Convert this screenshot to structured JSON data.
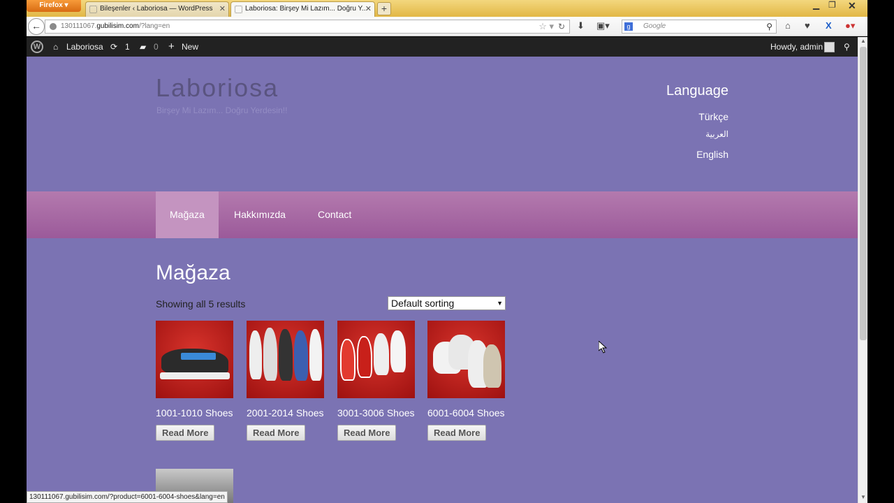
{
  "browser": {
    "app_button": "Firefox",
    "tabs": [
      {
        "title": "Bileşenler ‹ Laboriosa — WordPress",
        "active": false
      },
      {
        "title": "Laboriosa: Birşey Mi Lazım... Doğru Y...",
        "active": true
      }
    ],
    "url_prefix": "130111067.",
    "url_domain": "gubilisim.com",
    "url_rest": "/?lang=en",
    "search_placeholder": "Google",
    "status_url": "130111067.gubilisim.com/?product=6001-6004-shoes&lang=en"
  },
  "adminbar": {
    "site_name": "Laboriosa",
    "updates_count": "1",
    "comments_count": "0",
    "new_label": "New",
    "greeting": "Howdy, admin"
  },
  "site": {
    "title": "Laboriosa",
    "tagline": "Birşey Mi Lazım... Doğru Yerdesin!!",
    "language_heading": "Language",
    "languages": [
      "Türkçe",
      "العربية",
      "English"
    ],
    "menu": [
      "Mağaza",
      "Hakkımızda",
      "Contact"
    ],
    "page_title": "Mağaza",
    "result_count": "Showing all 5 results",
    "sorting_selected": "Default sorting",
    "products": [
      {
        "name": "1001-1010 Shoes",
        "button": "Read More"
      },
      {
        "name": "2001-2014 Shoes",
        "button": "Read More"
      },
      {
        "name": "3001-3006 Shoes",
        "button": "Read More"
      },
      {
        "name": "6001-6004 Shoes",
        "button": "Read More"
      }
    ]
  },
  "colors": {
    "site_bg": "#7b73b3",
    "menu_bg": "#a867a4",
    "menu_active": "#c494c0"
  }
}
